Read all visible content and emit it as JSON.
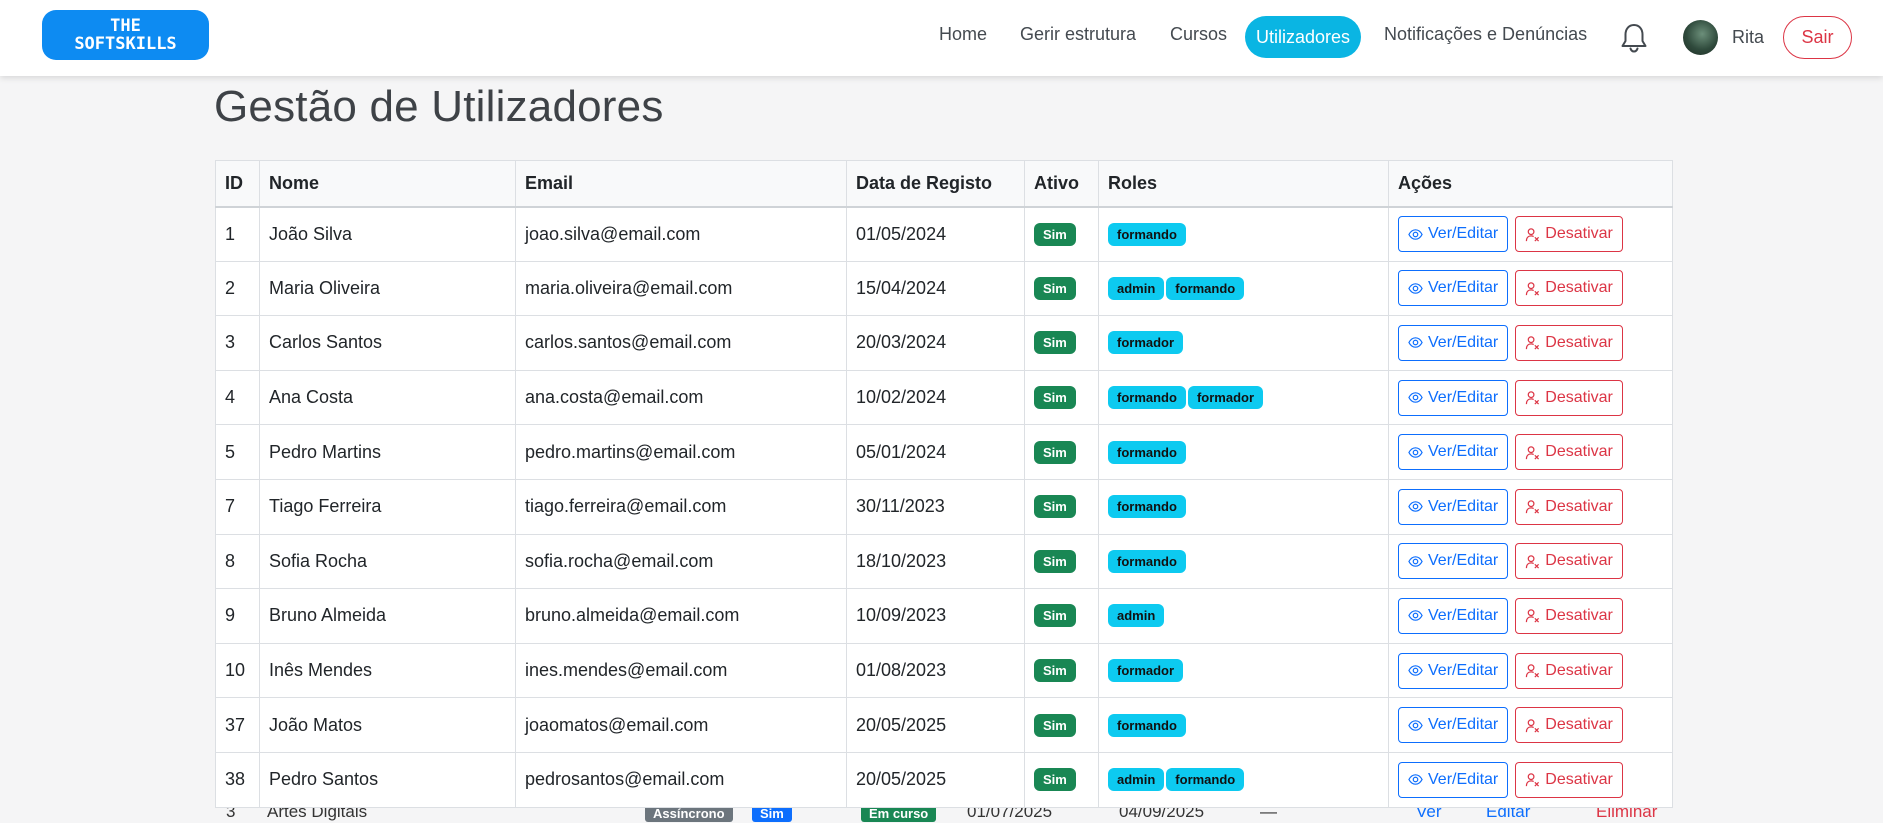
{
  "brand": {
    "line1": "THE",
    "line2": "SOFTSKILLS"
  },
  "nav": {
    "home": "Home",
    "structure": "Gerir estrutura",
    "courses": "Cursos",
    "users": "Utilizadores",
    "notifications": "Notificações e Denúncias"
  },
  "user": {
    "name": "Rita",
    "logout": "Sair"
  },
  "page": {
    "title": "Gestão de Utilizadores"
  },
  "table": {
    "headers": [
      "ID",
      "Nome",
      "Email",
      "Data de Registo",
      "Ativo",
      "Roles",
      "Ações"
    ],
    "actions": {
      "view": "Ver/Editar",
      "deactivate": "Desativar"
    },
    "rows": [
      {
        "id": "1",
        "name": "João Silva",
        "email": "joao.silva@email.com",
        "date": "01/05/2024",
        "active": "Sim",
        "roles": [
          "formando"
        ]
      },
      {
        "id": "2",
        "name": "Maria Oliveira",
        "email": "maria.oliveira@email.com",
        "date": "15/04/2024",
        "active": "Sim",
        "roles": [
          "admin",
          "formando"
        ]
      },
      {
        "id": "3",
        "name": "Carlos Santos",
        "email": "carlos.santos@email.com",
        "date": "20/03/2024",
        "active": "Sim",
        "roles": [
          "formador"
        ]
      },
      {
        "id": "4",
        "name": "Ana Costa",
        "email": "ana.costa@email.com",
        "date": "10/02/2024",
        "active": "Sim",
        "roles": [
          "formando",
          "formador"
        ]
      },
      {
        "id": "5",
        "name": "Pedro Martins",
        "email": "pedro.martins@email.com",
        "date": "05/01/2024",
        "active": "Sim",
        "roles": [
          "formando"
        ]
      },
      {
        "id": "7",
        "name": "Tiago Ferreira",
        "email": "tiago.ferreira@email.com",
        "date": "30/11/2023",
        "active": "Sim",
        "roles": [
          "formando"
        ]
      },
      {
        "id": "8",
        "name": "Sofia Rocha",
        "email": "sofia.rocha@email.com",
        "date": "18/10/2023",
        "active": "Sim",
        "roles": [
          "formando"
        ]
      },
      {
        "id": "9",
        "name": "Bruno Almeida",
        "email": "bruno.almeida@email.com",
        "date": "10/09/2023",
        "active": "Sim",
        "roles": [
          "admin"
        ]
      },
      {
        "id": "10",
        "name": "Inês Mendes",
        "email": "ines.mendes@email.com",
        "date": "01/08/2023",
        "active": "Sim",
        "roles": [
          "formador"
        ]
      },
      {
        "id": "37",
        "name": "João Matos",
        "email": "joaomatos@email.com",
        "date": "20/05/2025",
        "active": "Sim",
        "roles": [
          "formando"
        ]
      },
      {
        "id": "38",
        "name": "Pedro Santos",
        "email": "pedrosantos@email.com",
        "date": "20/05/2025",
        "active": "Sim",
        "roles": [
          "admin",
          "formando"
        ]
      }
    ]
  },
  "underlay_row": {
    "id": "3",
    "name": "Artes Digitais",
    "type": "Assíncrono",
    "flag": "Sim",
    "status": "Em curso",
    "start": "01/07/2025",
    "end": "04/09/2025",
    "dash": "—",
    "view": "Ver",
    "edit": "Editar",
    "delete": "Eliminar"
  },
  "colors": {
    "brand": "#0d8bf2",
    "nav_active": "#0ab5e3",
    "success": "#198754",
    "info": "#0dcaf0",
    "primary": "#0d6efd",
    "danger": "#dc3545"
  }
}
